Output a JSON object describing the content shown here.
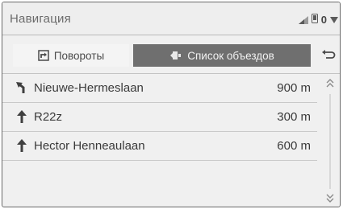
{
  "header": {
    "title": "Навигация",
    "status_count": "0",
    "icons": [
      "signal-icon",
      "phone-icon",
      "wifi-icon"
    ]
  },
  "tabs": [
    {
      "label": "Повороты",
      "icon": "turn-list-icon",
      "active": false
    },
    {
      "label": "Список объездов",
      "icon": "detour-icon",
      "active": true
    }
  ],
  "back_icon": "back-arrow-icon",
  "rows": [
    {
      "name": "Nieuwe-Hermeslaan",
      "distance": "900 m",
      "icon": "bear-left-arrow-icon"
    },
    {
      "name": "R22z",
      "distance": "300 m",
      "icon": "straight-arrow-icon"
    },
    {
      "name": "Hector Henneaulaan",
      "distance": "600 m",
      "icon": "straight-arrow-icon"
    }
  ],
  "colors": {
    "background": "#f0f0f0",
    "active_tab": "#6f6f6f",
    "text": "#3a3a3a"
  }
}
